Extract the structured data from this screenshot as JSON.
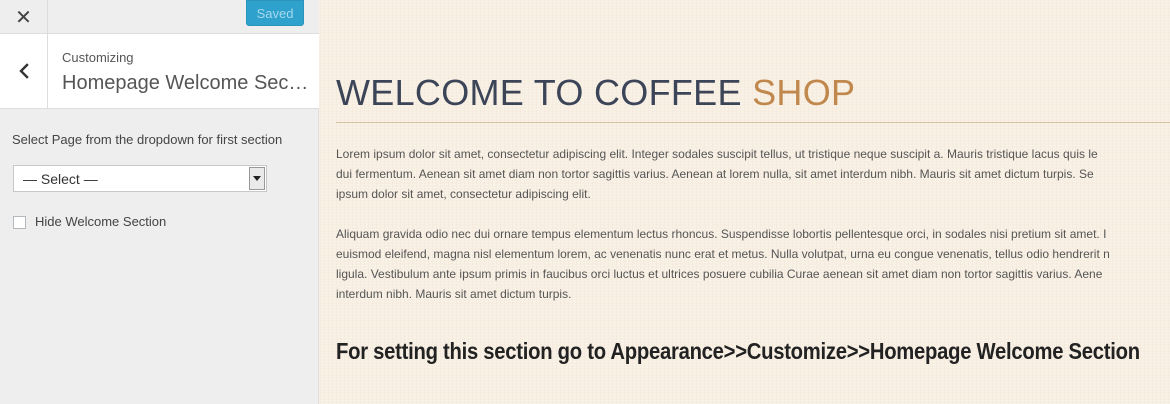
{
  "customizer": {
    "close_symbol": "✕",
    "save_button": "Saved",
    "customizing_label": "Customizing",
    "section_title": "Homepage Welcome Section",
    "page_select": {
      "label": "Select Page from the dropdown for first section",
      "selected": "— Select —"
    },
    "hide_checkbox": {
      "label": "Hide Welcome Section",
      "checked": false
    },
    "accent_color": "#2ea2cc"
  },
  "preview": {
    "heading_main": "WELCOME TO COFFEE ",
    "heading_accent": "SHOP",
    "heading_color": "#3c4558",
    "accent_color": "#c0884d",
    "paragraph1": [
      "Lorem ipsum dolor sit amet, consectetur adipiscing elit. Integer sodales suscipit tellus, ut tristique neque suscipit a. Mauris tristique lacus quis le",
      "dui fermentum. Aenean sit amet diam non tortor sagittis varius. Aenean at lorem nulla, sit amet interdum nibh. Mauris sit amet dictum turpis. Se",
      "ipsum dolor sit amet, consectetur adipiscing elit."
    ],
    "paragraph2": [
      "Aliquam gravida odio nec dui ornare tempus elementum lectus rhoncus. Suspendisse lobortis pellentesque orci, in sodales nisi pretium sit amet. I",
      "euismod eleifend, magna nisl elementum lorem, ac venenatis nunc erat et metus. Nulla volutpat, urna eu congue venenatis, tellus odio hendrerit n",
      "ligula. Vestibulum ante ipsum primis in faucibus orci luctus et ultrices posuere cubilia Curae aenean sit amet diam non tortor sagittis varius. Aene",
      "interdum nibh. Mauris sit amet dictum turpis."
    ],
    "setting_note": "For setting this section go to Appearance>>Customize>>Homepage Welcome Section"
  }
}
